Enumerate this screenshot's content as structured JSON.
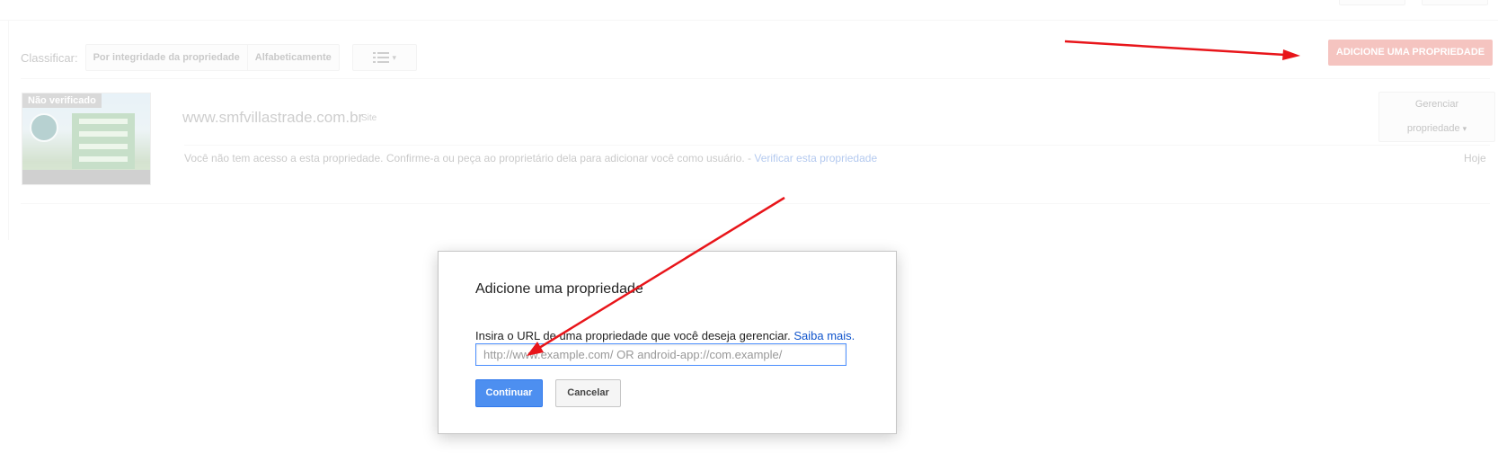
{
  "background": {
    "sort_label": "Classificar:",
    "sort_options": [
      "Por integridade da propriedade",
      "Alfabeticamente"
    ],
    "add_property_button": "ADICIONE UMA PROPRIEDADE",
    "property": {
      "badge": "Não verificado",
      "url": "www.smfvillastrade.com.br",
      "type": "Site",
      "notice": "Você não tem acesso a esta propriedade. Confirme-a ou peça ao proprietário dela para adicionar você como usuário. -",
      "verify_link": "Verificar esta propriedade",
      "manage_button_line1": "Gerenciar",
      "manage_button_line2": "propriedade",
      "date": "Hoje"
    }
  },
  "dialog": {
    "title": "Adicione uma propriedade",
    "prompt": "Insira o URL de uma propriedade que você deseja gerenciar.",
    "learn_more": "Saiba mais.",
    "input_placeholder": "http://www.example.com/ OR android-app://com.example/",
    "input_value": "",
    "continue_button": "Continuar",
    "cancel_button": "Cancelar"
  },
  "colors": {
    "accent_red": "#e0473b",
    "primary_blue": "#4d8ff0",
    "link_blue": "#1155cc",
    "annotation_arrow": "#e8151a"
  },
  "icons": [
    "list-view-icon",
    "chevron-down-icon"
  ]
}
